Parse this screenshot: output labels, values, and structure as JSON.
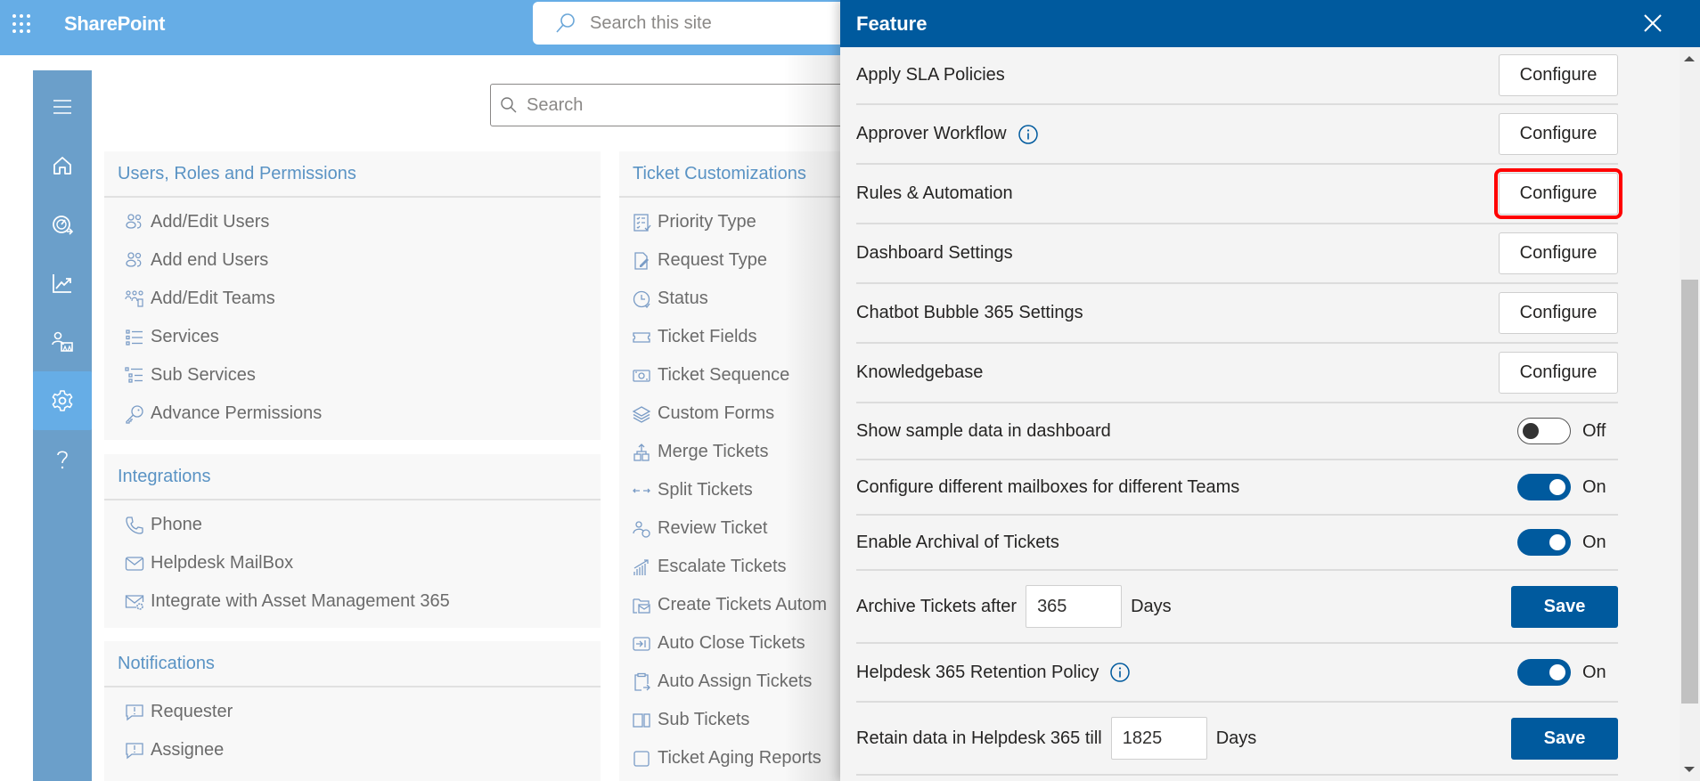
{
  "topbar": {
    "app_name": "SharePoint",
    "search_placeholder": "Search this site",
    "waffle_icon": "app-launcher-icon"
  },
  "rail": {
    "items": [
      {
        "name": "menu",
        "icon": "hamburger-icon"
      },
      {
        "name": "home",
        "icon": "home-icon"
      },
      {
        "name": "dashboard",
        "icon": "speedometer-icon"
      },
      {
        "name": "reports",
        "icon": "chart-line-icon"
      },
      {
        "name": "teams",
        "icon": "people-team-icon"
      },
      {
        "name": "settings",
        "icon": "gear-icon",
        "active": true
      },
      {
        "name": "help",
        "icon": "question-icon"
      }
    ]
  },
  "main": {
    "search_placeholder": "Search",
    "sections": {
      "users": {
        "title": "Users, Roles and Permissions",
        "items": [
          {
            "label": "Add/Edit Users",
            "icon": "people-icon"
          },
          {
            "label": "Add end Users",
            "icon": "people-icon"
          },
          {
            "label": "Add/Edit Teams",
            "icon": "team-icon"
          },
          {
            "label": "Services",
            "icon": "list-icon"
          },
          {
            "label": "Sub Services",
            "icon": "sublist-icon"
          },
          {
            "label": "Advance Permissions",
            "icon": "key-icon"
          }
        ]
      },
      "integrations": {
        "title": "Integrations",
        "items": [
          {
            "label": "Phone",
            "icon": "phone-icon"
          },
          {
            "label": "Helpdesk MailBox",
            "icon": "mail-icon"
          },
          {
            "label": "Integrate with Asset Management 365",
            "icon": "mail-settings-icon"
          }
        ]
      },
      "notifications": {
        "title": "Notifications",
        "items": [
          {
            "label": "Requester",
            "icon": "comment-alert-icon"
          },
          {
            "label": "Assignee",
            "icon": "comment-alert-icon"
          }
        ]
      },
      "ticket": {
        "title": "Ticket Customizations",
        "items": [
          {
            "label": "Priority Type",
            "icon": "checklist-icon"
          },
          {
            "label": "Request Type",
            "icon": "document-edit-icon"
          },
          {
            "label": "Status",
            "icon": "clock-icon"
          },
          {
            "label": "Ticket Fields",
            "icon": "ticket-icon"
          },
          {
            "label": "Ticket Sequence",
            "icon": "money-icon"
          },
          {
            "label": "Custom Forms",
            "icon": "layers-icon"
          },
          {
            "label": "Merge Tickets",
            "icon": "merge-icon"
          },
          {
            "label": "Split Tickets",
            "icon": "split-arrows-icon"
          },
          {
            "label": "Review Ticket",
            "icon": "people-sync-icon"
          },
          {
            "label": "Escalate Tickets",
            "icon": "escalate-chart-icon"
          },
          {
            "label": "Create Tickets Autom",
            "icon": "folder-mail-icon"
          },
          {
            "label": "Auto Close Tickets",
            "icon": "arrow-box-icon"
          },
          {
            "label": "Auto Assign Tickets",
            "icon": "clipboard-arrow-icon"
          },
          {
            "label": "Sub Tickets",
            "icon": "split-box-icon"
          },
          {
            "label": "Ticket Aging Reports",
            "icon": "square-icon"
          }
        ]
      }
    }
  },
  "panel": {
    "title": "Feature",
    "close_icon": "close-icon",
    "configure_rows": [
      {
        "label": "Apply SLA Policies",
        "button": "Configure",
        "info": false,
        "highlighted": false
      },
      {
        "label": "Approver Workflow",
        "button": "Configure",
        "info": true,
        "highlighted": false
      },
      {
        "label": "Rules & Automation",
        "button": "Configure",
        "info": false,
        "highlighted": true
      },
      {
        "label": "Dashboard Settings",
        "button": "Configure",
        "info": false,
        "highlighted": false
      },
      {
        "label": "Chatbot Bubble 365 Settings",
        "button": "Configure",
        "info": false,
        "highlighted": false
      },
      {
        "label": "Knowledgebase",
        "button": "Configure",
        "info": false,
        "highlighted": false
      }
    ],
    "toggle_rows": [
      {
        "label": "Show sample data in dashboard",
        "state": "Off",
        "on": false
      },
      {
        "label": "Configure different mailboxes for different Teams",
        "state": "On",
        "on": true
      },
      {
        "label": "Enable Archival of Tickets",
        "state": "On",
        "on": true
      }
    ],
    "archive": {
      "label": "Archive Tickets after",
      "value": "365",
      "unit": "Days",
      "button": "Save"
    },
    "retention": {
      "label": "Helpdesk 365 Retention Policy",
      "state": "On",
      "on": true,
      "info": true
    },
    "retain": {
      "label": "Retain data in Helpdesk 365 till",
      "value": "1825",
      "unit": "Days",
      "button": "Save"
    }
  },
  "colors": {
    "topbar": "#66ade6",
    "rail": "#6b9fca",
    "panel_header": "#005a9e",
    "accent": "#005a9e",
    "section_title": "#5a93c4",
    "highlight": "#ff0000"
  }
}
